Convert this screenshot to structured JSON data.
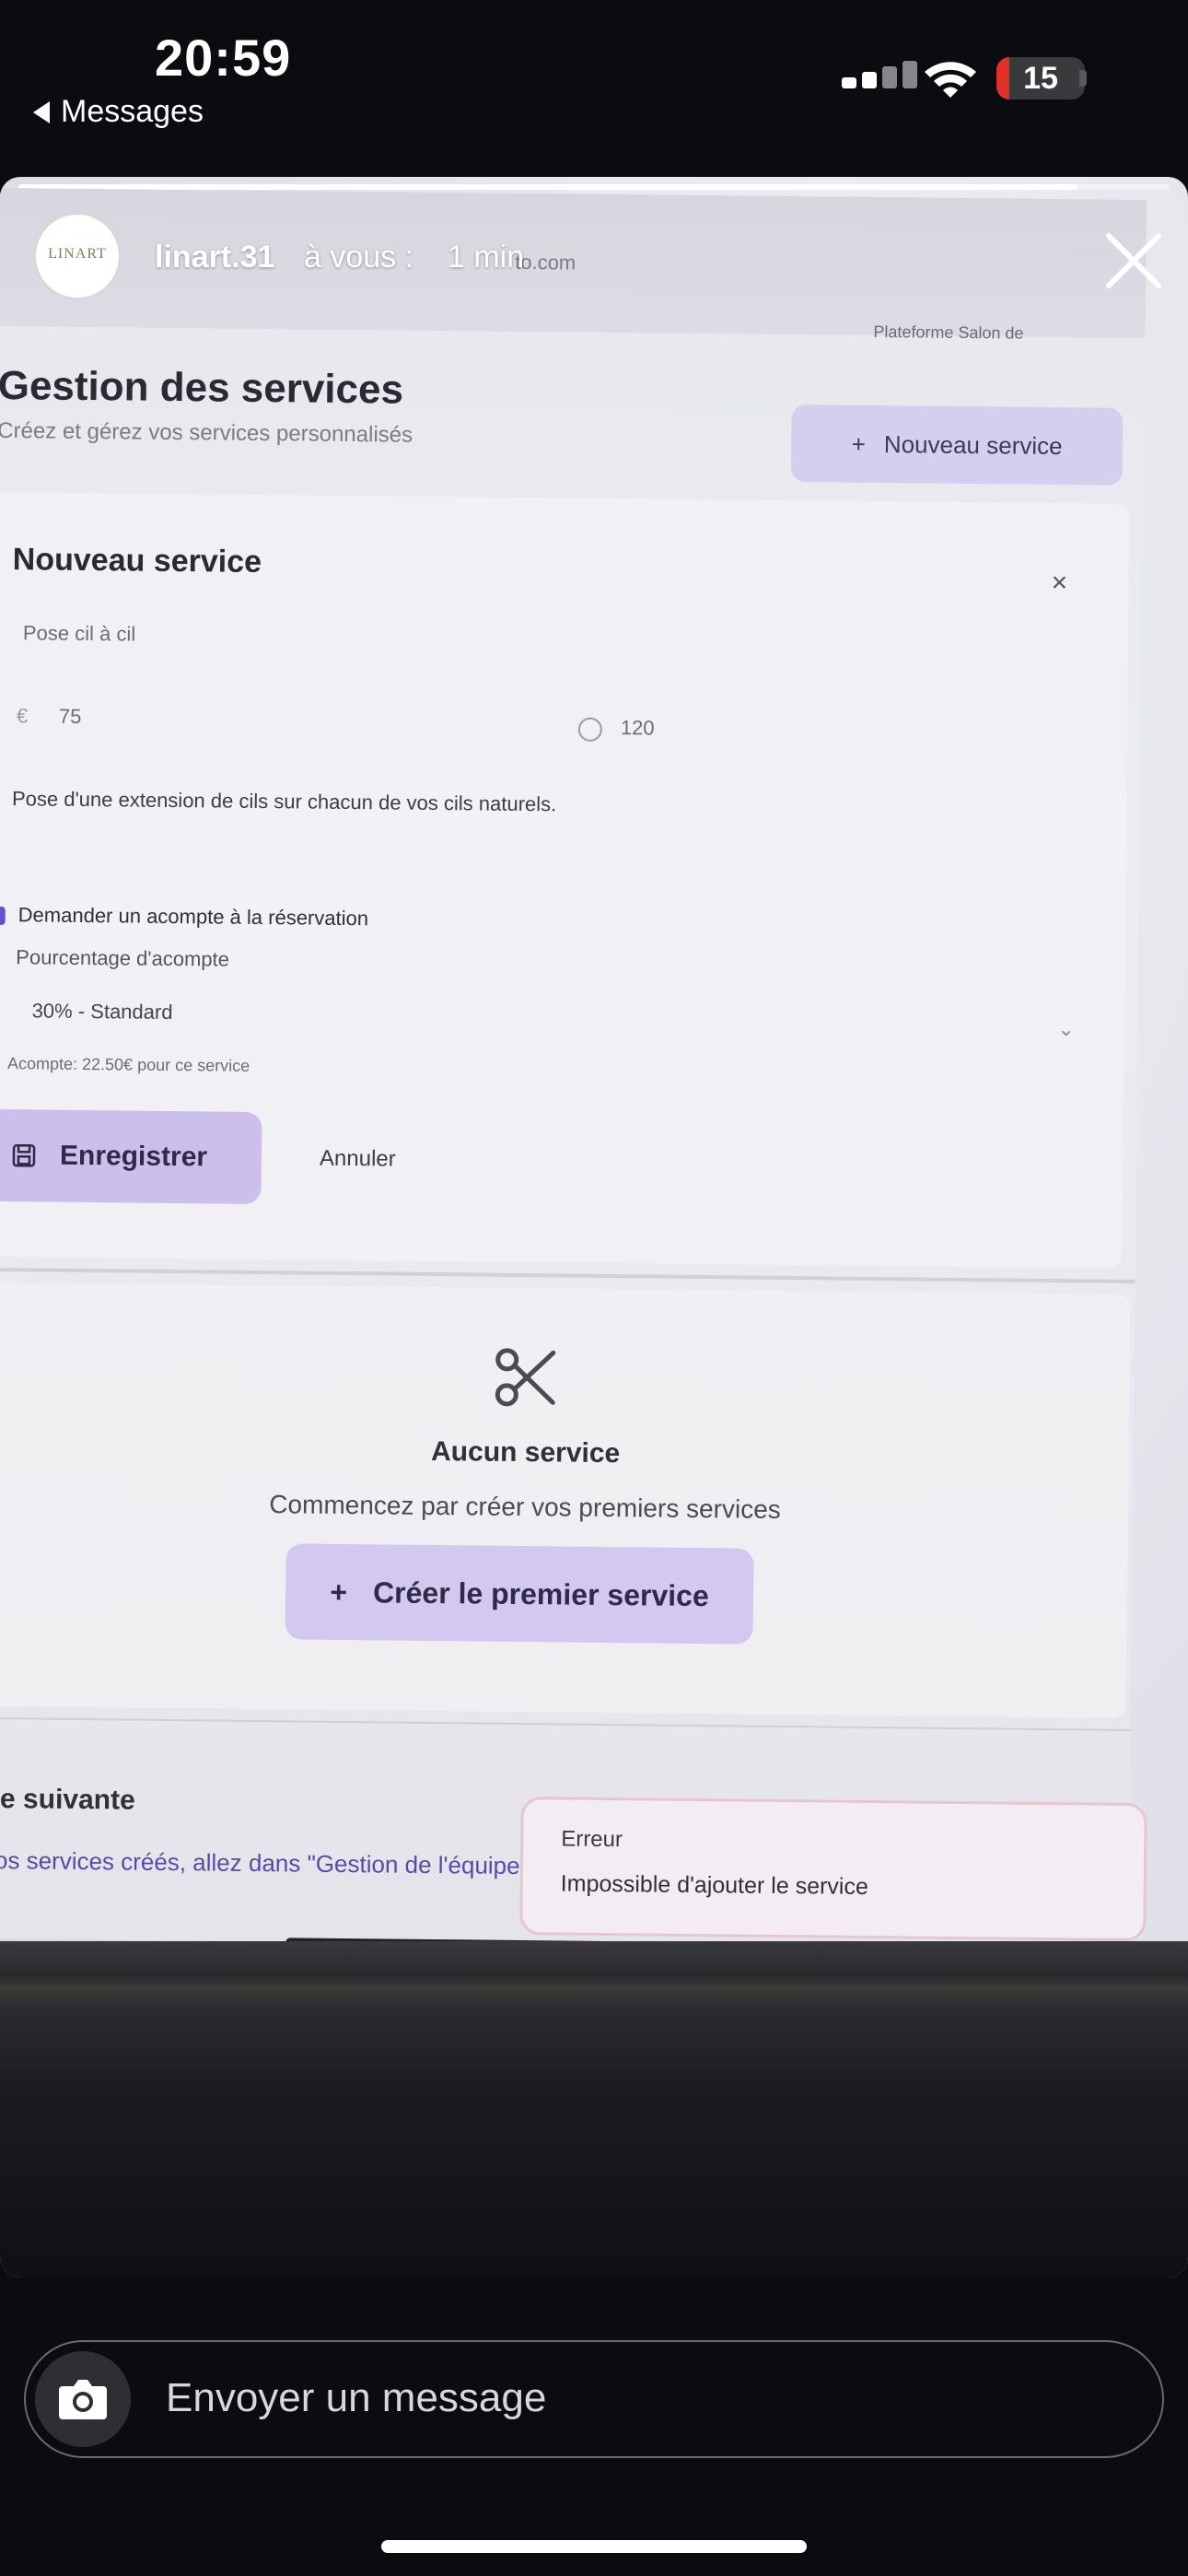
{
  "status_bar": {
    "time": "20:59",
    "back_label": "Messages",
    "battery_level": "15",
    "battery_fraction": 0.15
  },
  "story": {
    "progress_fraction": 0.92,
    "username": "linart.31",
    "to_label": "à vous :",
    "age": "1 min",
    "avatar_brand": "LINART"
  },
  "photo": {
    "page_title": "Gestion des services",
    "page_subtitle": "Créez et gérez vos services personnalisés",
    "new_service_button": "Nouveau service",
    "form_title": "Nouveau service",
    "close_glyph": "×",
    "service_name": "Pose cil à cil",
    "currency_symbol": "€",
    "price": "75",
    "duration": "120",
    "description": "Pose d'une extension de cils sur chacun de vos cils naturels.",
    "deposit_checkbox_label": "Demander un acompte à la réservation",
    "deposit_percent_label": "Pourcentage d'acompte",
    "deposit_selected": "30% - Standard",
    "deposit_hint": "Acompte: 22.50€ pour ce service",
    "save_button": "Enregistrer",
    "cancel_button": "Annuler",
    "empty_title": "Aucun service",
    "empty_subtitle": "Commencez par créer vos premiers services",
    "create_first_button": "Créer le premier service",
    "next_step_title": "pe suivante",
    "next_step_text": "vos services créés, allez dans \"Gestion de l'équipe\"",
    "toast_title": "Erreur",
    "toast_message": "Impossible d'ajouter le service",
    "url_fragment": "to.com",
    "tab_platform": "Plateforme Salon de"
  },
  "composer": {
    "placeholder": "Envoyer un message"
  },
  "icons": {
    "camera": "camera-icon",
    "close": "close-icon",
    "scissors": "scissors-icon",
    "plus": "plus-icon",
    "save": "save-icon",
    "clock": "clock-icon",
    "chevron": "chevron-down-icon",
    "wifi": "wifi-icon",
    "signal": "cellular-signal-icon",
    "battery": "battery-icon"
  }
}
